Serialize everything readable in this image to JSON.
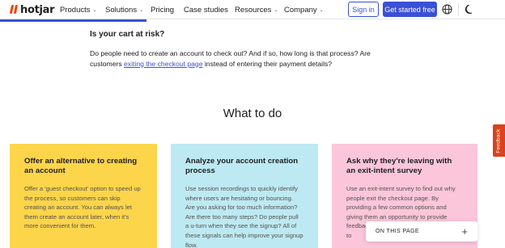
{
  "brand": {
    "name": "hotjar",
    "accent": "#ff3c00"
  },
  "nav": {
    "items": [
      {
        "label": "Products",
        "dropdown": true
      },
      {
        "label": "Solutions",
        "dropdown": true
      },
      {
        "label": "Pricing",
        "dropdown": false
      },
      {
        "label": "Case studies",
        "dropdown": false
      },
      {
        "label": "Resources",
        "dropdown": true
      },
      {
        "label": "Company",
        "dropdown": true
      }
    ],
    "signin_label": "Sign in",
    "cta_label": "Get started free",
    "primary_color": "#3a50d6"
  },
  "reading_progress": 0.29,
  "question": {
    "title": "Is your cart at risk?",
    "text_before": "Do people need to create an account to check out? And if so, how long is that process? Are customers ",
    "link_text": "exiting the checkout page",
    "text_after": " instead of entering their payment details?"
  },
  "section_title": "What to do",
  "cards": [
    {
      "title": "Offer an alternative to creating an account",
      "body": "Offer a 'guest checkout' option to speed up the process, so customers can skip creating an account. You can always let them create an account later, when it's more convenient for them.",
      "color": "#fcd54b"
    },
    {
      "title": "Analyze your account creation process",
      "body": "Use session recordings to quickly identify where users are hesitating or bouncing. Are you asking for too much information? Are there too many steps? Do people pull a u-turn when they see the signup? All of these signals can help improve your signup flow.",
      "color": "#bde9f3"
    },
    {
      "title": "Ask why they're leaving with an exit-intent survey",
      "body": "Use an exit-intent survey to find out why people exit the checkout page. By providing a few common options and giving them an opportunity to provide feedback, you can better u leaving- them to",
      "color": "#fbc6da"
    }
  ],
  "on_this_page": {
    "label": "ON THIS PAGE",
    "icon": "plus-icon"
  },
  "feedback_tab": {
    "label": "Feedback",
    "color": "#d9421b"
  }
}
